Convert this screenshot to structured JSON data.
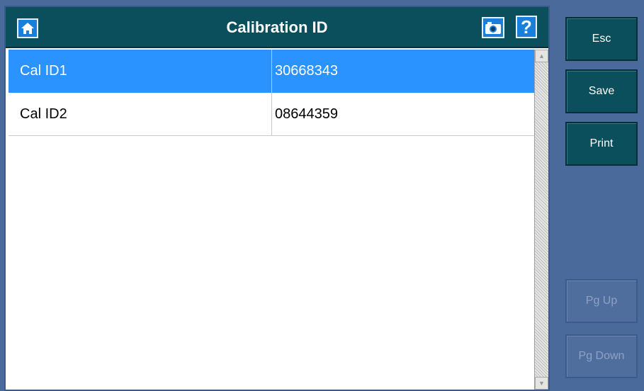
{
  "header": {
    "title": "Calibration ID",
    "home_icon": "home-icon",
    "camera_icon": "camera-icon",
    "help_label": "?"
  },
  "table": {
    "rows": [
      {
        "name": "Cal ID1",
        "value": "30668343",
        "selected": true
      },
      {
        "name": "Cal ID2",
        "value": "08644359",
        "selected": false
      }
    ]
  },
  "scrollbar": {
    "up_icon": "scroll-up-arrow-icon",
    "down_icon": "scroll-down-arrow-icon"
  },
  "side_buttons": {
    "esc": "Esc",
    "save": "Save",
    "print": "Print",
    "pg_up": "Pg Up",
    "pg_down": "Pg Down"
  },
  "colors": {
    "titlebar": "#0b4e5c",
    "selected_row": "#2b93ff",
    "background": "#4a6a9c"
  }
}
